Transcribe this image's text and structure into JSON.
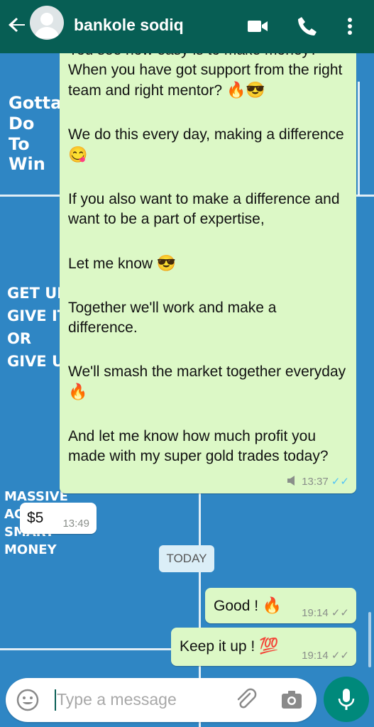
{
  "header": {
    "contact_name": "bankole sodiq",
    "icons": [
      "back-arrow-icon",
      "video-call-icon",
      "phone-icon",
      "more-options-icon"
    ]
  },
  "wallpaper": {
    "text_blocks": [
      {
        "lines": [
          "Gotta",
          "Do",
          "To",
          "Win"
        ]
      },
      {
        "lines": [
          "GET UP",
          "GIVE IT",
          "OR",
          "GIVE UP"
        ]
      },
      {
        "lines": [
          "MASSIVE",
          "ACTION",
          "SMART",
          "MONEY"
        ]
      }
    ]
  },
  "messages": [
    {
      "type": "outgoing",
      "paragraphs": [
        {
          "text": "You see how easy is to make money?"
        },
        {
          "text": "When you have got support from the right team and right mentor?",
          "emoji": "🔥😎"
        },
        {
          "text": "We do this every day, making a difference",
          "emoji": "😋"
        },
        {
          "text": "If you also want to make a difference and want to be a part of expertise,"
        },
        {
          "text": "Let me know",
          "emoji": "😎"
        },
        {
          "text": "Together we'll work and make a difference."
        },
        {
          "text": "We'll smash the market together everyday",
          "emoji": "🔥"
        },
        {
          "text": "And let me know how much profit you made with my super gold trades today?"
        }
      ],
      "time": "13:37",
      "status": "read"
    },
    {
      "type": "incoming",
      "text": "$5",
      "time": "13:49"
    },
    {
      "type": "outgoing",
      "text": "Good !",
      "emoji": "🔥",
      "time": "19:14",
      "status": "delivered"
    },
    {
      "type": "outgoing",
      "text": "Keep it up !",
      "emoji": "💯",
      "time": "19:14",
      "status": "delivered"
    }
  ],
  "date_divider": "TODAY",
  "input": {
    "placeholder": "Type a message",
    "icons": [
      "emoji-icon",
      "attach-icon",
      "camera-icon",
      "mic-icon"
    ]
  },
  "colors": {
    "header": "#075e54",
    "wallpaper": "#2f86c4",
    "outgoing_bubble": "#dcf8c6",
    "incoming_bubble": "#ffffff",
    "mic_button": "#00897b",
    "read_tick": "#4fc3f7"
  }
}
